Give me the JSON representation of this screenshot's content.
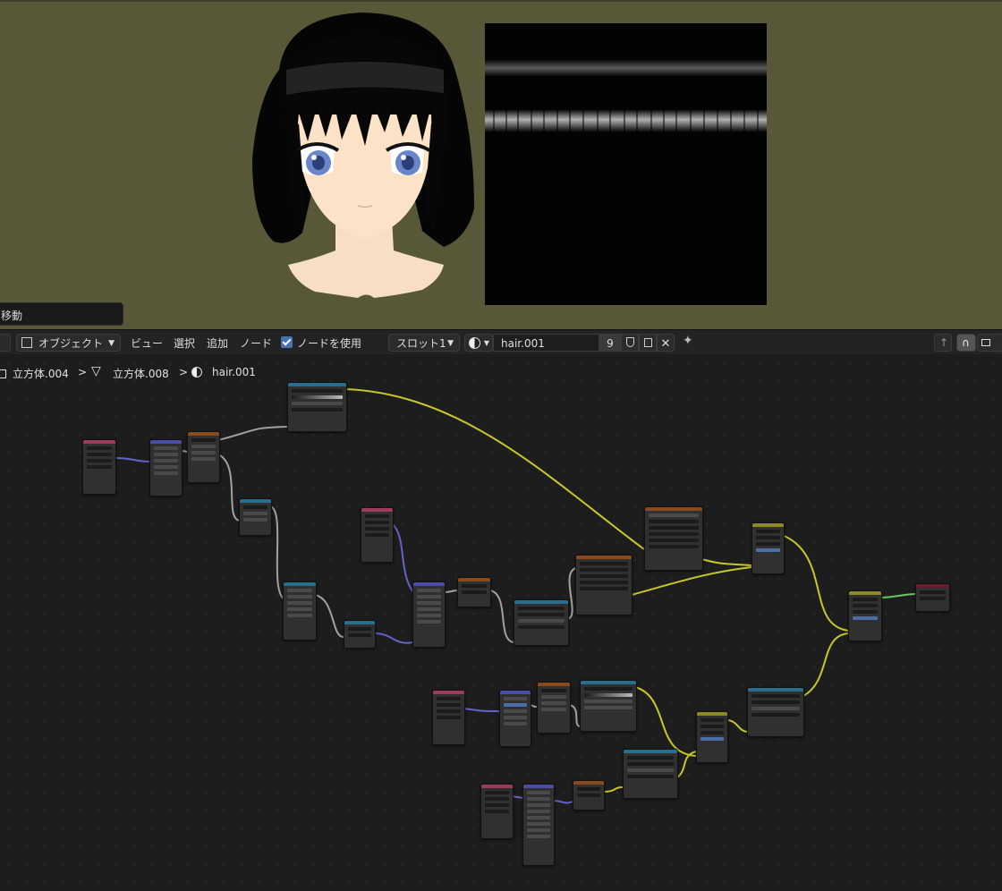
{
  "viewport": {
    "operator_panel": "移動"
  },
  "header": {
    "mode": "オブジェクト",
    "menus": [
      "ビュー",
      "選択",
      "追加",
      "ノード"
    ],
    "use_nodes_label": "ノードを使用",
    "use_nodes_checked": true,
    "slot": "スロット1",
    "material_name": "hair.001",
    "user_count": "9"
  },
  "breadcrumb": {
    "object": "立方体.004",
    "mesh": "立方体.008",
    "material": "hair.001"
  },
  "node_colors": {
    "input": "#a03a5a",
    "vector": "#4b4ba8",
    "converter": "#8b4a1c",
    "color": "#2a6e8e",
    "shader": "#8c8a22",
    "output": "#6b1c2c"
  },
  "wire_colors": {
    "color": "#c7c729",
    "vector": "#6363c7",
    "float": "#a1a1a1",
    "shader": "#63c763"
  }
}
